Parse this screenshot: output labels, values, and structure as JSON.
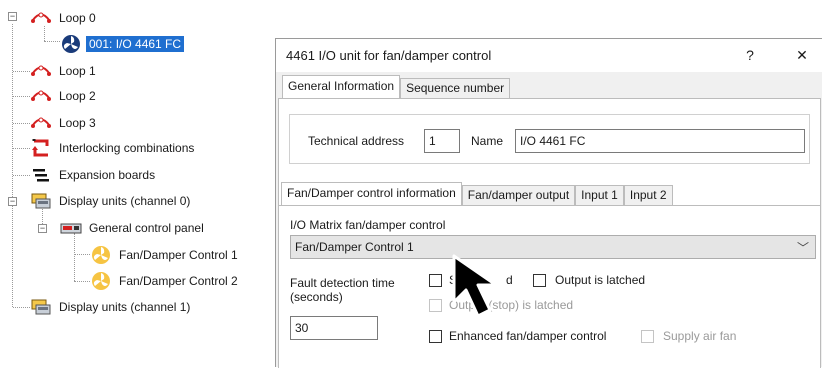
{
  "tree": {
    "items": [
      {
        "label": "Loop 0",
        "icon": "loop-icon",
        "expander": "−"
      },
      {
        "label": "001: I/O 4461 FC",
        "icon": "fan-unit-icon",
        "selected": true
      },
      {
        "label": "Loop 1",
        "icon": "loop-icon"
      },
      {
        "label": "Loop 2",
        "icon": "loop-icon"
      },
      {
        "label": "Loop 3",
        "icon": "loop-icon"
      },
      {
        "label": "Interlocking combinations",
        "icon": "interlock-icon"
      },
      {
        "label": "Expansion boards",
        "icon": "expansion-board-icon"
      },
      {
        "label": "Display units (channel 0)",
        "icon": "display-units-icon",
        "expander": "−"
      },
      {
        "label": "General control panel",
        "icon": "control-panel-icon",
        "expander": "−"
      },
      {
        "label": "Fan/Damper Control 1",
        "icon": "fan-damper-icon"
      },
      {
        "label": "Fan/Damper Control 2",
        "icon": "fan-damper-icon"
      },
      {
        "label": "Display units (channel 1)",
        "icon": "display-units-icon"
      }
    ]
  },
  "dialog": {
    "title": "4461 I/O unit for fan/damper control",
    "help": "?",
    "close": "✕",
    "tabs": [
      "General Information",
      "Sequence number"
    ],
    "technical_address_label": "Technical address",
    "technical_address_value": "1",
    "name_label": "Name",
    "name_value": "I/O 4461 FC",
    "inner_tabs": [
      "Fan/Damper control information",
      "Fan/damper output",
      "Input 1",
      "Input 2"
    ],
    "matrix_label": "I/O Matrix fan/damper control",
    "matrix_value": "Fan/Damper Control 1",
    "chevron": "﹀",
    "fault_label_1": "Fault detection time",
    "fault_label_2": "(seconds)",
    "fault_value": "30",
    "cb_supervised": "Su",
    "cb_supervised_tail": "d",
    "cb_output_latched": "Output is latched",
    "cb_output_stop_latched": "Output (stop) is latched",
    "cb_enhanced": "Enhanced fan/damper control",
    "cb_supply_air": "Supply air fan"
  }
}
